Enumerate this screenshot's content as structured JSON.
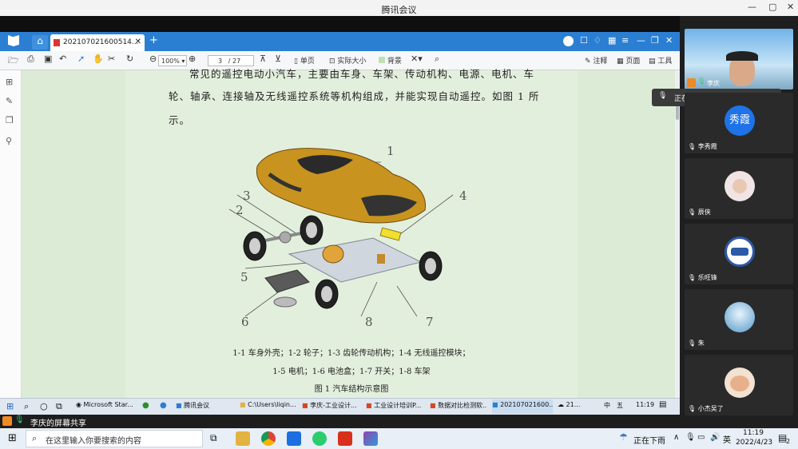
{
  "meeting": {
    "title": "腾讯会议",
    "min": "—",
    "max": "▢",
    "close": "✕"
  },
  "pdf": {
    "tab_title": "2021070216005​14...",
    "new_tab": "+",
    "zoom": "100%",
    "page_current": "3",
    "page_total": "/ 27",
    "tools": {
      "single": "单页",
      "actual": "实际大小",
      "bg": "背景",
      "annotate": "注释",
      "page": "页面",
      "tools": "工具"
    },
    "lines": [
      "常见的遥控电动小汽车，主要由车身、车架、传动机构、电源、电机、车",
      "轮、轴承、连接轴及无线遥控系统等机构组成，并能实现自动遥控。如图 1 所",
      "示。"
    ],
    "part_labels": {
      "l1": "1",
      "l2": "2",
      "l3": "3",
      "l4": "4",
      "l5": "5",
      "l6": "6",
      "l7": "7",
      "l8": "8"
    },
    "caption1": "1-1 车身外壳；1-2 轮子；1-3 齿轮传动机构；1-4 无线遥控模块；",
    "caption2": "1-5 电机；1-6 电池盒；1-7 开关；1-8 车架",
    "caption3": "图 1 汽车结构示意图"
  },
  "inner_taskbar": {
    "items": [
      "Microsoft Star...",
      "腾讯会议",
      "C:\\Users\\liqin...",
      "李庆-工业设计...",
      "工业设计培训P...",
      "数据对比检测软...",
      "2021070216​00...",
      "21..."
    ],
    "ime": "中",
    "ime2": "五",
    "time": "11:19"
  },
  "share_bar": {
    "label": "李庆的屏幕共享"
  },
  "participants": {
    "host": "李庆",
    "speaking": "正在讲话: 李庆;",
    "list": [
      {
        "name": "李秀霞",
        "avatar_text": "秀霞"
      },
      {
        "name": "辰侠"
      },
      {
        "name": "乐旺锋"
      },
      {
        "name": "朱"
      },
      {
        "name": "小杰吴了"
      }
    ]
  },
  "windows_taskbar": {
    "search_placeholder": "在这里输入你要搜索的内容",
    "weather": "正在下雨",
    "ime": "英",
    "time": "11:19",
    "date": "2022/4/23",
    "notifications": "2"
  },
  "colors": {
    "pdf_blue": "#2b7fd3",
    "page_bg": "#e3efdd",
    "car": "#c8931f"
  }
}
